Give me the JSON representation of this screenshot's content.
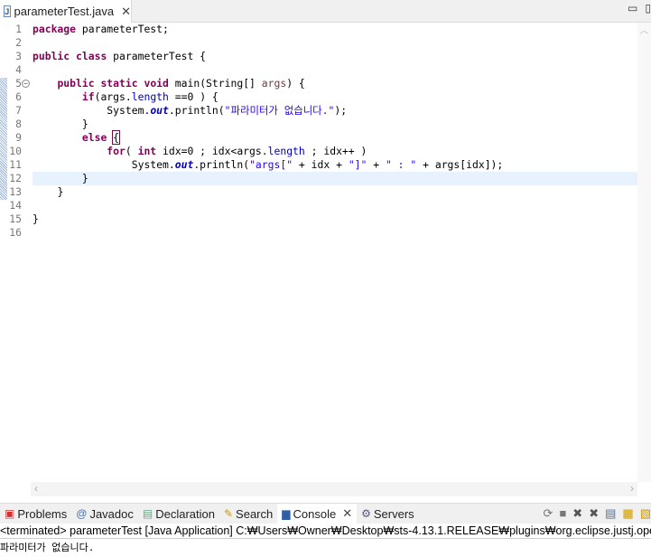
{
  "editor": {
    "tab_title": "parameterTest.java",
    "file_icon": "java-file-icon",
    "lines": [
      {
        "n": "1"
      },
      {
        "n": "2"
      },
      {
        "n": "3"
      },
      {
        "n": "4"
      },
      {
        "n": "5"
      },
      {
        "n": "6"
      },
      {
        "n": "7"
      },
      {
        "n": "8"
      },
      {
        "n": "9"
      },
      {
        "n": "10"
      },
      {
        "n": "11"
      },
      {
        "n": "12"
      },
      {
        "n": "13"
      },
      {
        "n": "14"
      },
      {
        "n": "15"
      },
      {
        "n": "16"
      }
    ],
    "code": {
      "l1a": "package",
      "l1b": " parameterTest;",
      "l3a": "public",
      "l3b": " ",
      "l3c": "class",
      "l3d": " parameterTest {",
      "l5a": "public",
      "l5b": "static",
      "l5c": "void",
      "l5d": " main(String[] ",
      "l5e": "args",
      "l5f": ") {",
      "l6a": "if",
      "l6b": "(args.",
      "l6c": "length",
      "l6d": " ==0 ) {",
      "l7a": "System.",
      "l7b": "out",
      "l7c": ".println(",
      "l7d": "\"파라미터가 없습니다.\"",
      "l7e": ");",
      "l8": "}",
      "l9a": "else",
      "l9b": "{",
      "l10a": "for",
      "l10b": "( ",
      "l10c": "int",
      "l10d": " idx=0 ; idx<args.",
      "l10e": "length",
      "l10f": " ; idx++ )",
      "l11a": "System.",
      "l11b": "out",
      "l11c": ".println(",
      "l11d": "\"args[\"",
      "l11e": " + idx + ",
      "l11f": "\"]\"",
      "l11g": " + ",
      "l11h": "\" : \"",
      "l11i": " + args[idx]);",
      "l12": "}",
      "l13": "}",
      "l15": "}"
    }
  },
  "panel": {
    "tabs": [
      {
        "label": "Problems"
      },
      {
        "label": "Javadoc"
      },
      {
        "label": "Declaration"
      },
      {
        "label": "Search"
      },
      {
        "label": "Console"
      },
      {
        "label": "Servers"
      }
    ],
    "status": "<terminated> parameterTest [Java Application] C:₩Users₩Owner₩Desktop₩sts-4.13.1.RELEASE₩plugins₩org.eclipse.justj.openjdk.hotspot",
    "output": "파라미터가 없습니다."
  }
}
